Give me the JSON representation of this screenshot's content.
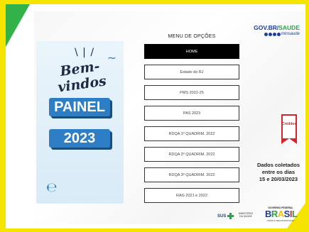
{
  "poster": {
    "welcome": "Bem-vindos",
    "panel": "PAINEL",
    "year": "2023"
  },
  "menu": {
    "title": "MENU DE OPÇÕES",
    "items": [
      {
        "label": "HOME",
        "active": true
      },
      {
        "label": "Estado do RJ"
      },
      {
        "label": "PMS 2022-25"
      },
      {
        "label": "PAS 2023"
      },
      {
        "label": "RDQA 1º QUADRIM. 2022"
      },
      {
        "label": "RDQA 2º QUADRIM. 2022"
      },
      {
        "label": "RDQA 3º QUADRIM. 2022"
      },
      {
        "label": "RAG 2021 e 2022"
      }
    ]
  },
  "header": {
    "gov": "GOV.BR",
    "slash": "/",
    "saude": "SAUDE",
    "handle": "minsaude"
  },
  "creditos": "Créditos",
  "dados": {
    "line1": "Dados coletados",
    "line2": "entre os dias",
    "line3": "15 e 20/03/2023"
  },
  "footer": {
    "sus": "SUS",
    "ministerio": "MINISTÉRIO DA SAÚDE",
    "governo": "GOVERNO FEDERAL",
    "brasil_letters": [
      "B",
      "R",
      "A",
      "S",
      "I",
      "L"
    ],
    "brasil_tagline": "UNIÃO E RECONSTRUÇÃO"
  },
  "colors": {
    "brand_yellow": "#f5e400",
    "brand_green": "#33b24a",
    "brand_blue": "#1c3f94",
    "accent_red": "#d8232a"
  }
}
